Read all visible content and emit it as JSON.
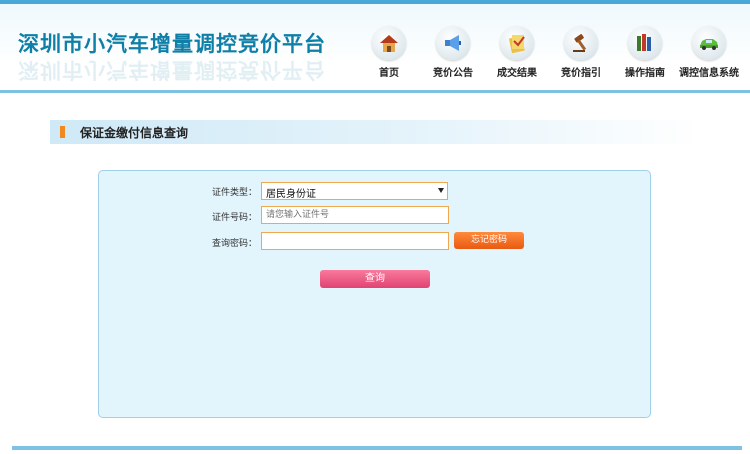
{
  "header": {
    "logo_text": "深圳市小汽车增量调控竞价平台",
    "nav": [
      {
        "label": "首页",
        "icon": "home-icon"
      },
      {
        "label": "竞价公告",
        "icon": "megaphone-icon"
      },
      {
        "label": "成交结果",
        "icon": "document-icon"
      },
      {
        "label": "竞价指引",
        "icon": "gavel-icon"
      },
      {
        "label": "操作指南",
        "icon": "books-icon"
      },
      {
        "label": "调控信息系统",
        "icon": "car-icon"
      }
    ]
  },
  "section": {
    "title": "保证金缴付信息查询"
  },
  "form": {
    "id_type_label": "证件类型：",
    "id_type_value": "居民身份证",
    "id_number_label": "证件号码：",
    "id_number_placeholder": "请您输入证件号",
    "password_label": "查询密码：",
    "password_value": "",
    "forgot_button": "忘记密码",
    "query_button": "查询"
  },
  "colors": {
    "brand": "#0f7fa8",
    "accent_orange": "#f08a1e",
    "query_pink": "#e04372",
    "panel_bg": "#e3f5fc"
  }
}
